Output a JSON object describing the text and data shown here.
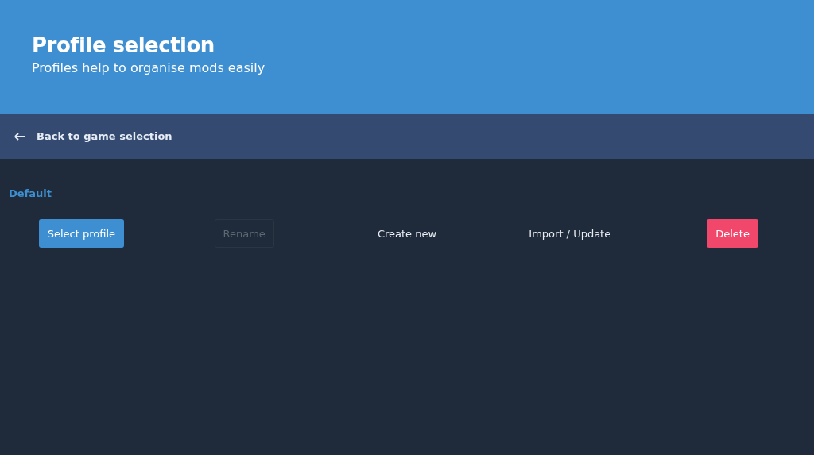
{
  "header": {
    "title": "Profile selection",
    "subtitle": "Profiles help to organise mods easily"
  },
  "nav": {
    "back_link": "Back to game selection"
  },
  "profiles": [
    {
      "name": "Default",
      "selected": true
    }
  ],
  "actions": [
    {
      "label": "Select profile",
      "kind": "primary",
      "disabled": false
    },
    {
      "label": "Rename",
      "kind": "plain",
      "disabled": true
    },
    {
      "label": "Create new",
      "kind": "plain",
      "disabled": false
    },
    {
      "label": "Import / Update",
      "kind": "plain",
      "disabled": false
    },
    {
      "label": "Delete",
      "kind": "danger",
      "disabled": false
    }
  ]
}
